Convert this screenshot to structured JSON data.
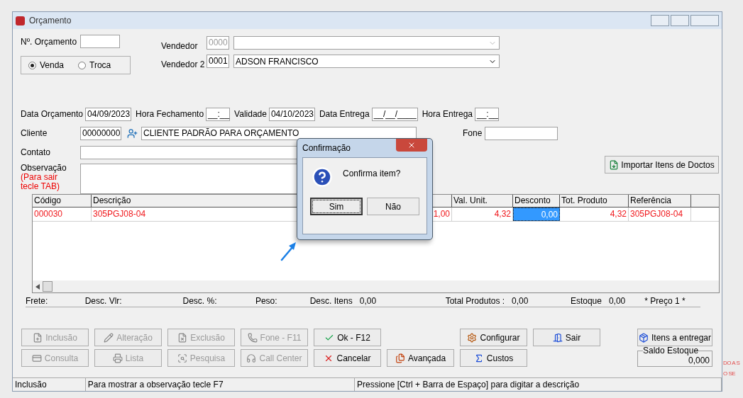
{
  "window": {
    "title": "Orçamento"
  },
  "numero_orcamento": {
    "label": "Nº. Orçamento"
  },
  "tipo": [
    {
      "label": "Venda",
      "selected": true
    },
    {
      "label": "Troca",
      "selected": false
    }
  ],
  "vendedores": [
    {
      "label": "Vendedor",
      "code": "0000",
      "disabled": true
    },
    {
      "label": "Vendedor 2",
      "code": "0001",
      "name": "ADSON FRANCISCO",
      "disabled": false
    }
  ],
  "datas": [
    {
      "label": "Data Orçamento",
      "value": "04/09/2023"
    },
    {
      "label": "Hora Fechamento",
      "value": "__:__"
    },
    {
      "label": "Validade",
      "value": "04/10/2023"
    },
    {
      "label": "Data Entrega",
      "value": "__/__/____"
    },
    {
      "label": "Hora Entrega",
      "value": "__:__"
    }
  ],
  "cliente": {
    "label": "Cliente",
    "code": "00000000",
    "name": "CLIENTE PADRÃO PARA ORÇAMENTO"
  },
  "fone": {
    "label": "Fone"
  },
  "contato": {
    "label": "Contato"
  },
  "observacao": {
    "label": "Observação",
    "hint": "(Para sair tecle TAB)"
  },
  "import_button": "Importar Itens de Doctos",
  "grid": {
    "columns": [
      "Código",
      "Descrição",
      "",
      "Val. Unit.",
      "Desconto",
      "Tot. Produto",
      "Referência"
    ],
    "rows": [
      {
        "cells": [
          {
            "text": "000030",
            "selected": false
          },
          {
            "text": "305PGJ08-04",
            "selected": false
          },
          {
            "text": "1,00",
            "selected": false
          },
          {
            "text": "4,32",
            "selected": false
          },
          {
            "text": "0,00",
            "selected": true
          },
          {
            "text": "4,32",
            "selected": false
          },
          {
            "text": "305PGJ08-04",
            "selected": false
          }
        ]
      }
    ]
  },
  "totals": [
    {
      "label": "Frete:"
    },
    {
      "label": "Desc. Vlr:"
    },
    {
      "label": "Desc. %:"
    },
    {
      "label": "Peso:"
    },
    {
      "label": "Desc. Itens",
      "value": "0,00"
    },
    {
      "label": "Total Produtos :",
      "value": "0,00"
    },
    {
      "label": "Estoque",
      "value": "0,00"
    },
    {
      "label": "* Preço 1 *"
    }
  ],
  "buttons_row_1": [
    {
      "label": "Inclusão",
      "disabled": true
    },
    {
      "label": "Alteração",
      "disabled": true
    },
    {
      "label": "Exclusão",
      "disabled": true
    },
    {
      "label": "Fone - F11",
      "disabled": true
    },
    {
      "label": "Ok - F12",
      "disabled": false
    },
    {
      "label": "Configurar",
      "disabled": false
    },
    {
      "label": "Sair",
      "disabled": false
    }
  ],
  "buttons_row_2": [
    {
      "label": "Consulta",
      "disabled": true
    },
    {
      "label": "Lista",
      "disabled": true
    },
    {
      "label": "Pesquisa",
      "disabled": true
    },
    {
      "label": "Call Center",
      "disabled": true
    },
    {
      "label": "Cancelar",
      "disabled": false
    },
    {
      "label": "Avançada",
      "disabled": false
    },
    {
      "label": "Custos",
      "disabled": false
    }
  ],
  "itens_button": "Itens a entregar",
  "saldo_estoque": {
    "label": "Saldo Estoque",
    "value": "0,000"
  },
  "status_bar": [
    "Inclusão",
    "Para mostrar a observação tecle F7",
    "Pressione [Ctrl + Barra de Espaço] para digitar a descrição"
  ],
  "dialog": {
    "title": "Confirmação",
    "message": "Confirma item?",
    "buttons": [
      {
        "label": "Sim",
        "focused": true
      },
      {
        "label": "Não",
        "focused": false
      }
    ]
  },
  "background_fragments": [
    "DO A S",
    "O SE"
  ]
}
